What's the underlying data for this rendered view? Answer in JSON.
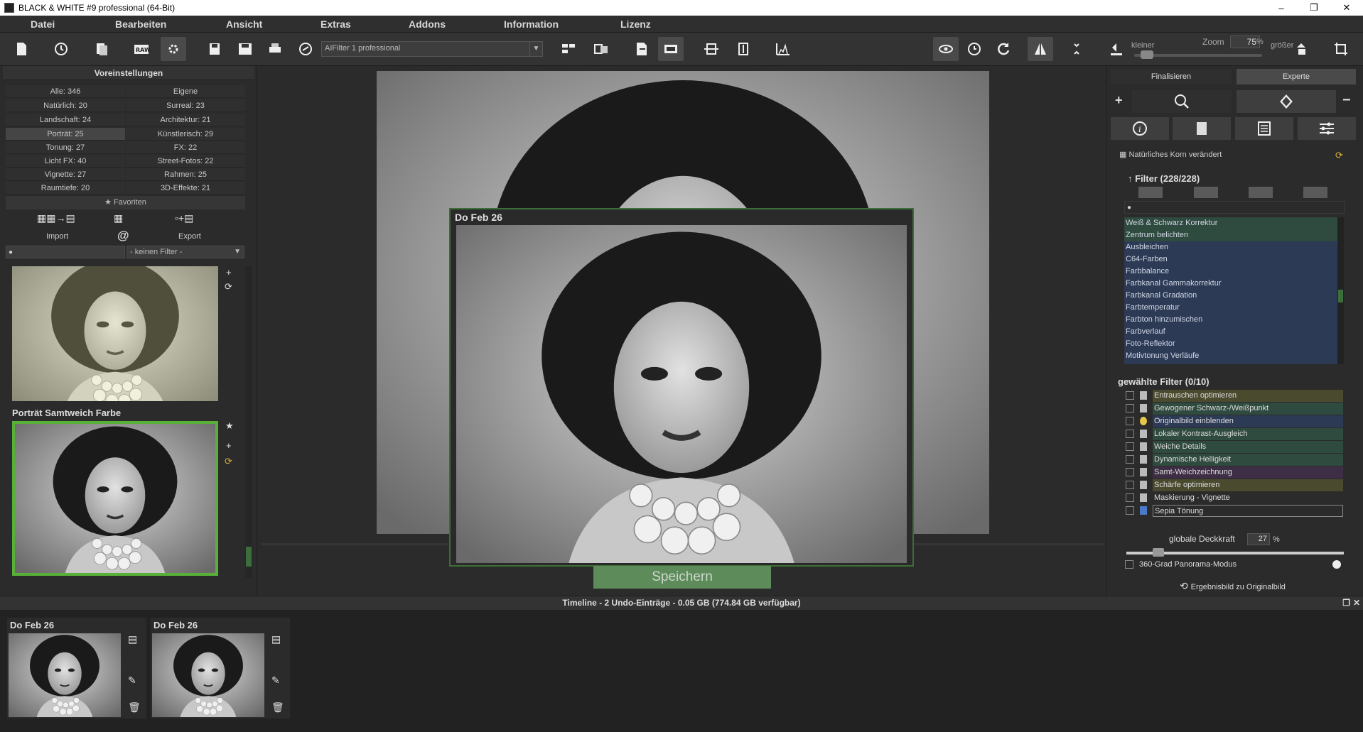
{
  "window": {
    "title": "BLACK & WHITE #9 professional (64-Bit)",
    "min": "–",
    "max": "❐",
    "close": "✕"
  },
  "menu": [
    "Datei",
    "Bearbeiten",
    "Ansicht",
    "Extras",
    "Addons",
    "Information",
    "Lizenz"
  ],
  "toolbar": {
    "preset_value": "AIFilter 1 professional",
    "zoom_label": "Zoom",
    "zoom_value": "75",
    "zoom_unit": "%",
    "smaller": "kleiner",
    "larger": "größer"
  },
  "presets": {
    "header": "Voreinstellungen",
    "categories_left": [
      "Alle: 346",
      "Natürlich: 20",
      "Landschaft: 24",
      "Porträt: 25",
      "Tonung: 27",
      "Licht FX: 40",
      "Vignette: 27",
      "Raumtiefe: 20"
    ],
    "categories_right": [
      "Eigene",
      "Surreal: 23",
      "Architektur: 21",
      "Künstlerisch: 29",
      "FX: 22",
      "Street-Fotos: 22",
      "Rahmen: 25",
      "3D-Effekte: 21"
    ],
    "favorites": "Favoriten",
    "import": "Import",
    "export": "Export",
    "filter_select": "- keinen Filter -",
    "selected_caption": "Porträt Samtweich Farbe"
  },
  "canvas": {
    "popup_title": "Do Feb 26",
    "save_button": "Speichern"
  },
  "right": {
    "tab_finalize": "Finalisieren",
    "tab_expert": "Experte",
    "grain_status": "Natürliches Korn verändert",
    "filter_header": "Filter (228/228)",
    "filters": [
      "Weiß & Schwarz Korrektur",
      "Zentrum belichten",
      "Ausbleichen",
      "C64-Farben",
      "Farbbalance",
      "Farbkanal Gammakorrektur",
      "Farbkanal Gradation",
      "Farbtemperatur",
      "Farbton hinzumischen",
      "Farbverlauf",
      "Foto-Reflektor",
      "Motivtonung Verläufe"
    ],
    "selected_header": "gewählte Filter (0/10)",
    "selected_filters": [
      "Entrauschen optimieren",
      "Gewogener Schwarz-/Weißpunkt",
      "Originalbild einblenden",
      "Lokaler Kontrast-Ausgleich",
      "Weiche Details",
      "Dynamische Helligkeit",
      "Samt-Weichzeichnung",
      "Schärfe optimieren",
      "Maskierung - Vignette",
      "Sepia Tönung"
    ],
    "opacity_label": "globale Deckkraft",
    "opacity_value": "27",
    "opacity_unit": "%",
    "panorama": "360-Grad Panorama-Modus",
    "result_to_original": "Ergebnisbild zu Originalbild"
  },
  "timeline": {
    "header": "Timeline - 2 Undo-Einträge - 0.05 GB (774.84 GB verfügbar)",
    "entries": [
      {
        "date": "Do Feb 26"
      },
      {
        "date": "Do Feb 26"
      }
    ]
  }
}
